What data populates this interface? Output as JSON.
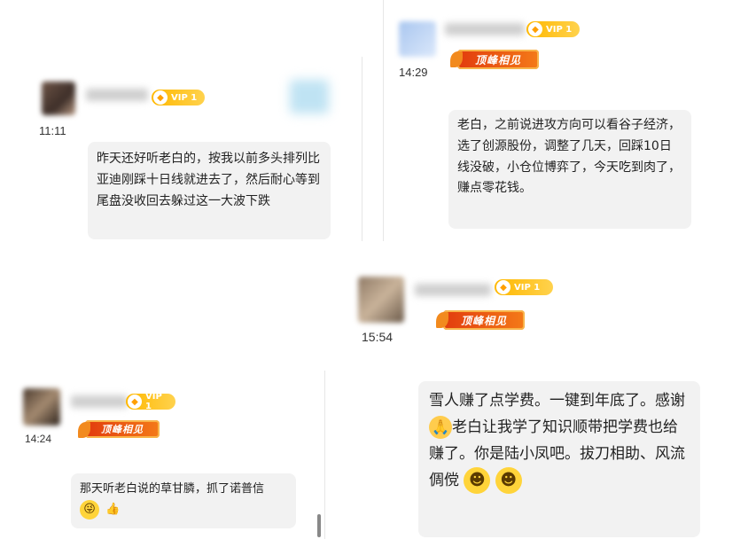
{
  "posts": [
    {
      "id": "post-1",
      "time": "11:11",
      "vip": "VIP 1",
      "message": "昨天还好听老白的，按我以前多头排列比亚迪刚踩十日线就进去了，然后耐心等到尾盘没收回去躲过这一大波下跌"
    },
    {
      "id": "post-2",
      "time": "14:29",
      "vip": "VIP 1",
      "badge": "顶峰相见",
      "message": "老白，之前说进攻方向可以看谷子经济，选了创源股份，调整了几天，回踩10日线没破，小仓位博弈了，今天吃到肉了，赚点零花钱。"
    },
    {
      "id": "post-3",
      "time": "15:54",
      "vip": "VIP 1",
      "badge": "顶峰相见",
      "message_parts": [
        "雪人赚了点学费。一键到年底了。感谢",
        "老白让我学了知识顺带把学费也给赚了。你是陆小凤吧。拔刀相助、风流倜傥"
      ]
    },
    {
      "id": "post-4",
      "time": "14:24",
      "vip": "VIP 1",
      "badge": "顶峰相见",
      "message": "那天听老白说的草甘膦，抓了诺普信"
    }
  ],
  "colors": {
    "vip": "#ffb800",
    "badge": "#e23b0e",
    "bubble": "#f2f2f2"
  },
  "icons": [
    "gem-icon",
    "pray-emoji",
    "smile-emoji",
    "wink-emoji",
    "thumbs-up-emoji"
  ]
}
